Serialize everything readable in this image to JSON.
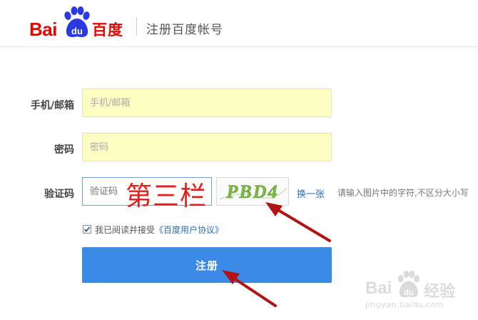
{
  "header": {
    "logo_latin": "Bai",
    "logo_du": "du",
    "logo_cn": "百度",
    "title": "注册百度帐号"
  },
  "form": {
    "phone": {
      "label": "手机/邮箱",
      "placeholder": "手机/邮箱",
      "value": ""
    },
    "password": {
      "label": "密码",
      "placeholder": "密码",
      "value": ""
    },
    "captcha": {
      "label": "验证码",
      "placeholder": "验证码",
      "value": "",
      "image_text": "PBD4",
      "refresh_label": "换一张",
      "hint": "请输入图片中的字符,不区分大小写"
    },
    "agreement": {
      "checked": true,
      "text": "我已阅读并接受",
      "link": "《百度用户协议》"
    },
    "submit_label": "注册"
  },
  "annotation": {
    "overlay_text": "第三栏",
    "color": "#e0201a"
  },
  "watermark": {
    "brand_latin": "Bai",
    "brand_du": "du",
    "brand_cn": "经验",
    "url": "jingyan.baidu.com"
  },
  "colors": {
    "brand_red": "#e10602",
    "button_blue": "#3b8ae8",
    "input_yellow": "#fbfdc3",
    "link_blue": "#2b6fb6"
  }
}
